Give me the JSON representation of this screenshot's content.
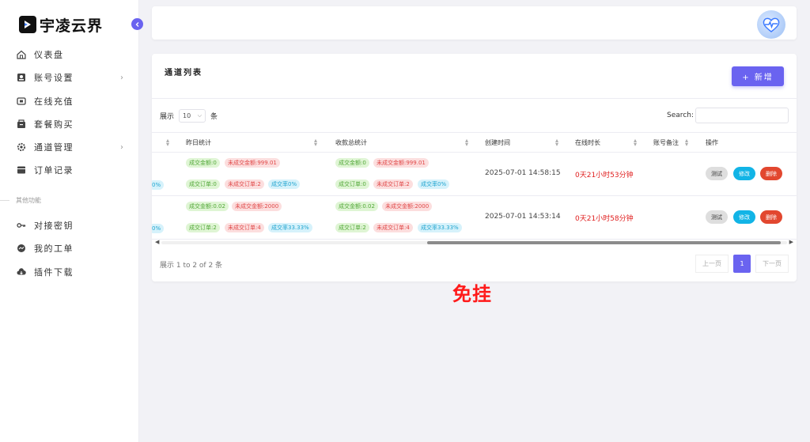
{
  "brand": {
    "name": "宇凌云界"
  },
  "sidebar": {
    "items": [
      {
        "label": "仪表盘",
        "icon": "home-icon"
      },
      {
        "label": "账号设置",
        "icon": "user-card-icon",
        "has_arrow": true
      },
      {
        "label": "在线充值",
        "icon": "wallet-icon"
      },
      {
        "label": "套餐购买",
        "icon": "package-icon"
      },
      {
        "label": "通道管理",
        "icon": "gear-icon",
        "has_arrow": true
      },
      {
        "label": "订单记录",
        "icon": "order-icon"
      }
    ],
    "section_label": "其他功能",
    "extra_items": [
      {
        "label": "对接密钥",
        "icon": "key-icon"
      },
      {
        "label": "我的工单",
        "icon": "chat-icon"
      },
      {
        "label": "插件下载",
        "icon": "cloud-download-icon"
      }
    ]
  },
  "main": {
    "title": "通道列表",
    "add_button": "+ 新增",
    "show_prefix": "展示",
    "page_size": "10",
    "show_suffix": "条",
    "search_label": "Search:",
    "columns": [
      "昨日统计",
      "收款总统计",
      "创建时间",
      "在线时长",
      "账号备注",
      "操作"
    ],
    "rows": [
      {
        "left_rate": "0%",
        "yesterday": {
          "amount": "成交金额:0",
          "unpaid_amount": "未成交金额:999.01",
          "orders": "成交订单:0",
          "unpaid_orders": "未成交订单:2",
          "rate": "成交率0%"
        },
        "total": {
          "amount": "成交金额:0",
          "unpaid_amount": "未成交金额:999.01",
          "orders": "成交订单:0",
          "unpaid_orders": "未成交订单:2",
          "rate": "成交率0%"
        },
        "created": "2025-07-01 14:58:15",
        "online": "0天21小时53分钟"
      },
      {
        "left_rate": "0%",
        "yesterday": {
          "amount": "成交金额:0.02",
          "unpaid_amount": "未成交金额:2000",
          "orders": "成交订单:2",
          "unpaid_orders": "未成交订单:4",
          "rate": "成交率33.33%"
        },
        "total": {
          "amount": "成交金额:0.02",
          "unpaid_amount": "未成交金额:2000",
          "orders": "成交订单:2",
          "unpaid_orders": "未成交订单:4",
          "rate": "成交率33.33%"
        },
        "created": "2025-07-01 14:53:14",
        "online": "0天21小时58分钟"
      }
    ],
    "actions": {
      "test": "测试",
      "edit": "修改",
      "delete": "删除"
    },
    "info": "展示 1 to 2 of 2 条",
    "pager": {
      "prev": "上一页",
      "current": "1",
      "next": "下一页"
    }
  },
  "overlay_text": "免挂",
  "colors": {
    "accent": "#6a63f0",
    "danger": "#e2472f",
    "info": "#12b4e6"
  }
}
